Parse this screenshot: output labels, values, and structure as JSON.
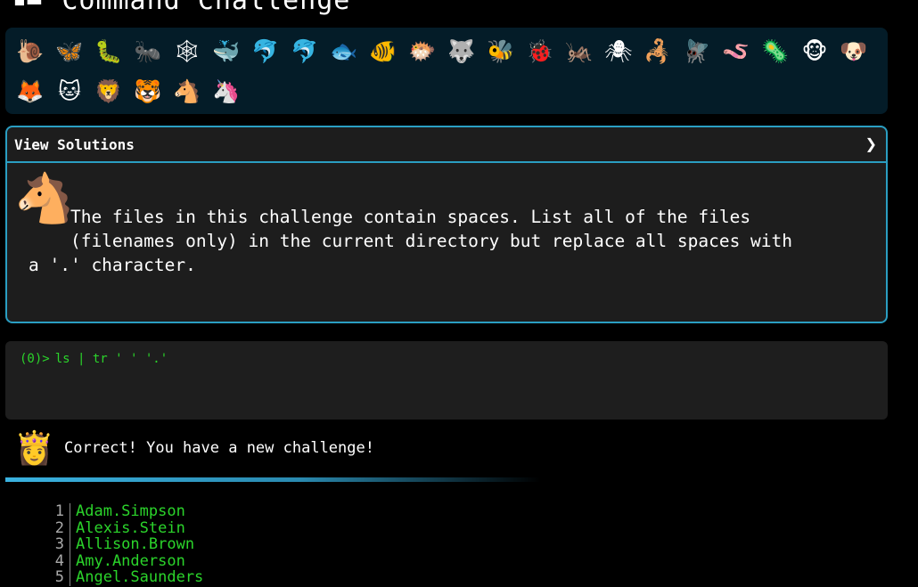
{
  "header": {
    "title": "Command Challenge",
    "icon": "terminal-icon"
  },
  "critters": {
    "row1": [
      "🐌",
      "🦋",
      "🐛",
      "🐜",
      "🕸",
      "🐳",
      "🐬",
      "🐬",
      "🐟",
      "🐠",
      "🐡",
      "🐺",
      "🐝",
      "🐞",
      "🦗",
      "🕷",
      "🦂",
      "🪰",
      "🪱",
      "🦠",
      "🐵",
      "🐶"
    ],
    "row2": [
      "🦊",
      "🐱",
      "🦁",
      "🐯",
      "🐴",
      "🦄"
    ]
  },
  "solutions_panel": {
    "label": "View Solutions",
    "chevron": "❯",
    "avatar": "🐴",
    "description": "    The files in this challenge contain spaces. List all of the files\n    (filenames only) in the current directory but replace all spaces with\na '.' character."
  },
  "terminal": {
    "prompt": "(0)>",
    "command": "ls | tr ' ' '.'"
  },
  "status": {
    "avatar": "👸",
    "message": "Correct! You have a new challenge!"
  },
  "output": {
    "lines": [
      {
        "n": "1",
        "name": "Adam.Simpson"
      },
      {
        "n": "2",
        "name": "Alexis.Stein"
      },
      {
        "n": "3",
        "name": "Allison.Brown"
      },
      {
        "n": "4",
        "name": "Amy.Anderson"
      },
      {
        "n": "5",
        "name": "Angel.Saunders"
      }
    ]
  },
  "colors": {
    "accent": "#2a9ec2",
    "terminal_green": "#2bd42b",
    "panel_bg": "#1d1d1d",
    "critter_bg": "#041c28"
  }
}
